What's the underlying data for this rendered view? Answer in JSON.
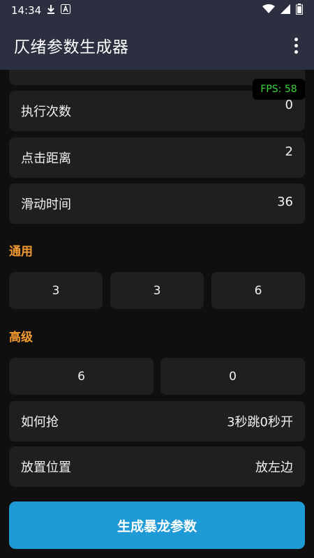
{
  "status_bar": {
    "time": "14:34"
  },
  "app_bar": {
    "title": "仄绪参数生成器"
  },
  "fps_overlay": {
    "text": "FPS: 58"
  },
  "rows": [
    {
      "label": "执行次数",
      "value": "0"
    },
    {
      "label": "点击距离",
      "value": "2"
    },
    {
      "label": "滑动时间",
      "value": "36"
    }
  ],
  "general": {
    "title": "通用",
    "values": [
      "3",
      "3",
      "6"
    ]
  },
  "advanced": {
    "title": "高级",
    "values": [
      "6",
      "0"
    ],
    "rows": [
      {
        "label": "如何抢",
        "value": "3秒跳0秒开"
      },
      {
        "label": "放置位置",
        "value": "放左边"
      }
    ]
  },
  "generate_button": {
    "label": "生成暴龙参数"
  },
  "colors": {
    "appbar": "#2c2f3f",
    "background": "#0f0f0f",
    "card": "#1f1f1f",
    "section_title": "#f29a2f",
    "primary_button": "#1e9ad6",
    "fps_text": "#3cd43c"
  }
}
